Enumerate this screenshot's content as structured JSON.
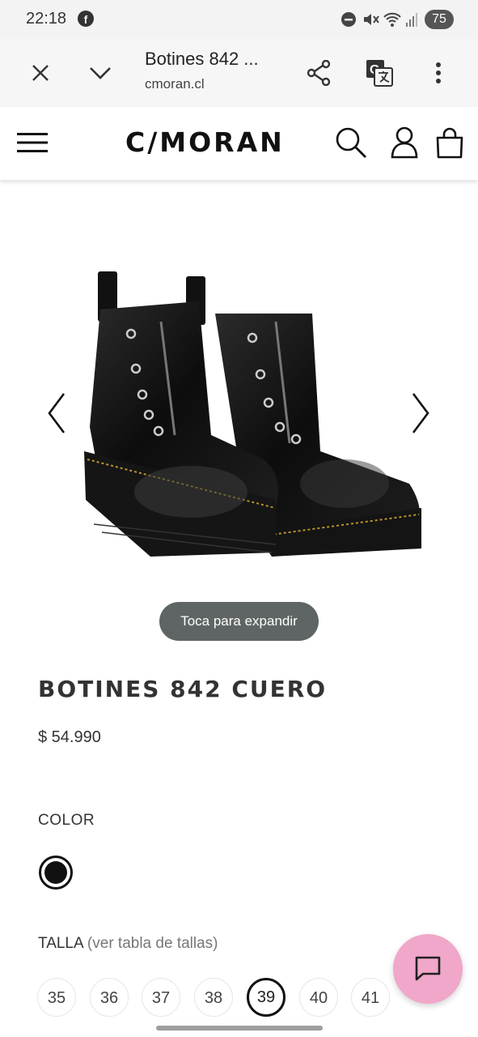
{
  "status_bar": {
    "time": "22:18",
    "battery": "75"
  },
  "browser": {
    "title": "Botines 842 ...",
    "url": "cmoran.cl"
  },
  "site": {
    "logo": "C/MORAN"
  },
  "gallery": {
    "expand_hint": "Toca para expandir"
  },
  "product": {
    "name": "BOTINES 842 CUERO",
    "price": "$ 54.990",
    "color_label": "COLOR",
    "color_selected": "#111111",
    "size_label": "TALLA",
    "size_chart_link": "(ver tabla de tallas)",
    "sizes": [
      "35",
      "36",
      "37",
      "38",
      "39",
      "40",
      "41"
    ],
    "selected_size": "39"
  }
}
